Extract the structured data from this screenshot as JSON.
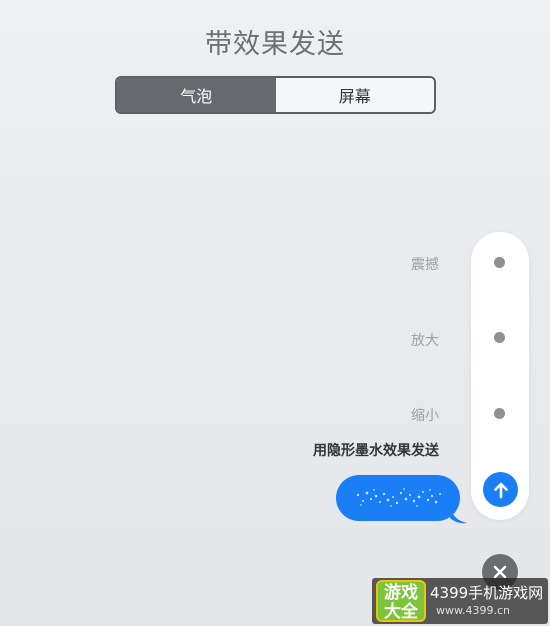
{
  "header": {
    "title": "带效果发送"
  },
  "segments": {
    "bubble_label": "气泡",
    "screen_label": "屏幕",
    "selected": "气泡"
  },
  "effects": [
    {
      "label": "震撼"
    },
    {
      "label": "放大"
    },
    {
      "label": "缩小"
    }
  ],
  "selected_effect_hint": "用隐形墨水效果发送",
  "colors": {
    "accent": "#1a7ef5",
    "segment_active": "#66696d",
    "close_button": "#6b6d70"
  },
  "icons": {
    "send": "arrow-up-icon",
    "close": "close-icon"
  },
  "watermark": {
    "logo_text_line1": "游戏",
    "logo_text_line2": "大全",
    "site_name": "4399手机游戏网",
    "site_url": "www.4399.cn"
  }
}
